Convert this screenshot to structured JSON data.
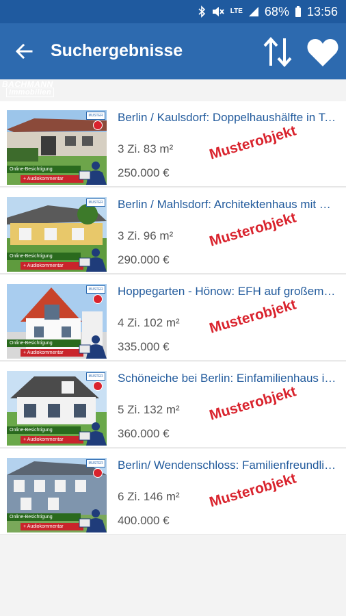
{
  "statusbar": {
    "network": "LTE",
    "battery": "68%",
    "time": "13:56"
  },
  "appbar": {
    "title": "Suchergebnisse",
    "back_icon": "arrow-left-icon",
    "sort_icon": "sort-arrows-icon",
    "favorite_icon": "heart-icon"
  },
  "logo": {
    "line1": "BACHMANN",
    "line2": "Immobilien"
  },
  "listings": [
    {
      "title": "Berlin / Kaulsdorf: Doppelhaushälfte in Toplage",
      "rooms": "3 Zi.  83 m²",
      "price": "250.000 €",
      "stamp": "Musterobjekt"
    },
    {
      "title": "Berlin / Mahlsdorf: Architektenhaus mit Garten",
      "rooms": "3 Zi.  96 m²",
      "price": "290.000 €",
      "stamp": "Musterobjekt"
    },
    {
      "title": "Hoppegarten - Hönow: EFH auf großem Grundstück",
      "rooms": "4 Zi.  102 m²",
      "price": "335.000 €",
      "stamp": "Musterobjekt"
    },
    {
      "title": "Schöneiche bei Berlin: Einfamilienhaus im Grünen",
      "rooms": "5 Zi.  132 m²",
      "price": "360.000 €",
      "stamp": "Musterobjekt"
    },
    {
      "title": "Berlin/ Wendenschloss:  Familienfreundliches Haus",
      "rooms": "6 Zi.  146 m²",
      "price": "400.000 €",
      "stamp": "Musterobjekt"
    }
  ],
  "thumb_labels": {
    "badge": "MUSTER",
    "online": "Online-Besichtigung",
    "audio": "+ Audiokommentar"
  },
  "colors": {
    "statusbar": "#1f5a9f",
    "appbar": "#2d6aaf",
    "title_text": "#215a9c",
    "stamp": "#d9232d"
  }
}
